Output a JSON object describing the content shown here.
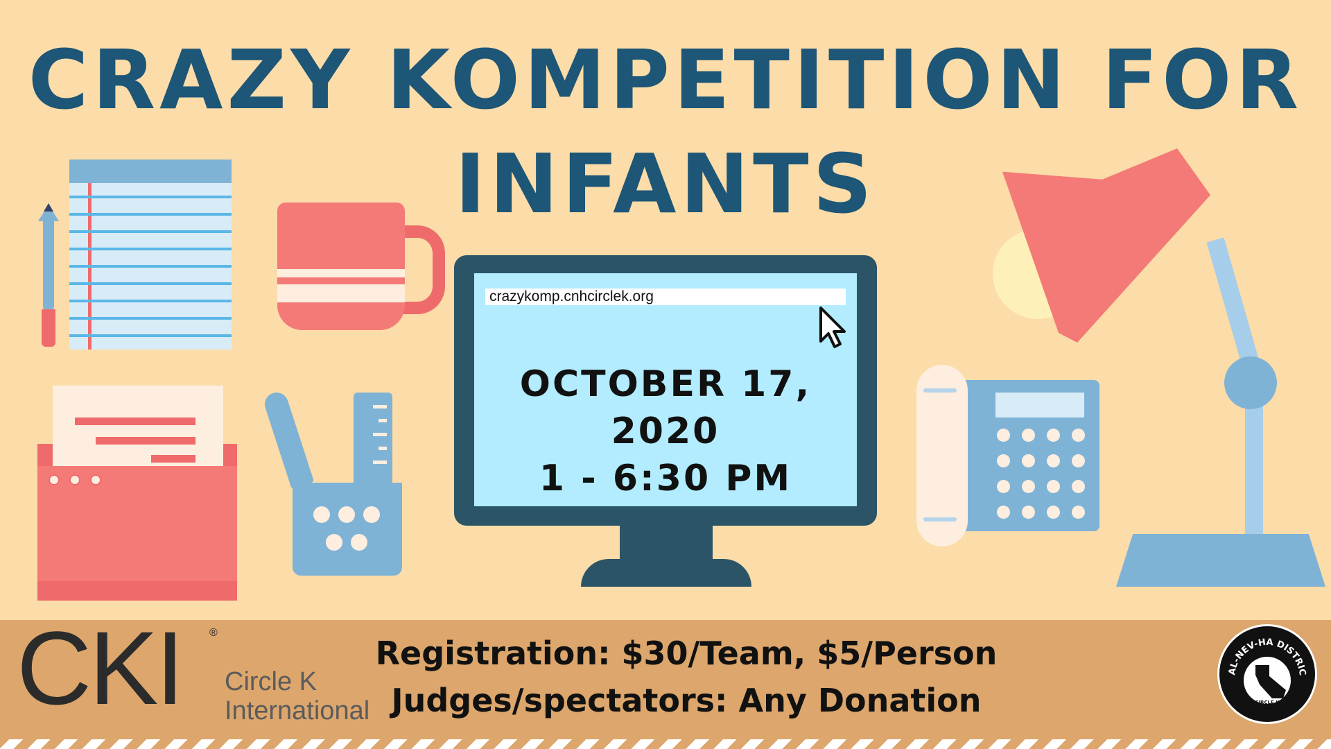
{
  "title": {
    "line1": "CRAZY KOMPETITION FOR",
    "line2": "INFANTS"
  },
  "monitor": {
    "url": "crazykomp.cnhcirclek.org",
    "date": "OCTOBER 17, 2020",
    "time": "1 - 6:30 PM"
  },
  "footer": {
    "logo_letters": "CKI",
    "logo_reg": "®",
    "logo_line1": "Circle K",
    "logo_line2": "International",
    "registration": "Registration: $30/Team, $5/Person",
    "judges": "Judges/spectators: Any Donation",
    "seal_top": "CAL-NEV-HA DISTRICT",
    "seal_line1": "CIRCLE K",
    "seal_line2": "INTERNATIONAL"
  },
  "colors": {
    "background": "#fcdca8",
    "title": "#1d5676",
    "banner": "#dca66c",
    "coral": "#f47a77",
    "blue": "#7fb3d6",
    "monitor": "#2b5567",
    "screen": "#b2ecfe"
  },
  "icons": [
    "notepad-icon",
    "pen-icon",
    "mug-icon",
    "folder-icon",
    "pencil-cup-icon",
    "monitor-icon",
    "cursor-icon",
    "phone-icon",
    "desk-lamp-icon",
    "district-seal-icon"
  ]
}
